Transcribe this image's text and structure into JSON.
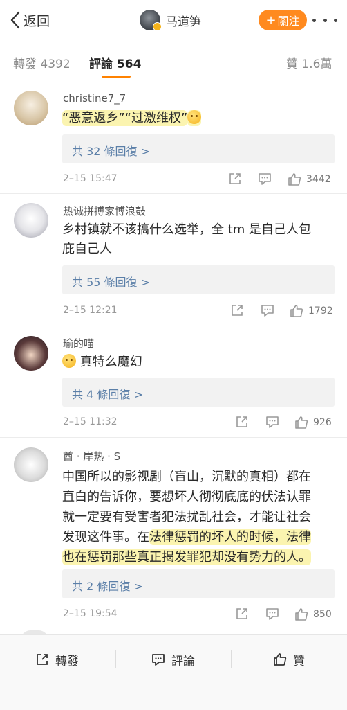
{
  "nav": {
    "back_label": "返回",
    "account_name": "马道笋",
    "follow_label": "關注",
    "follow_plus": "+"
  },
  "tabs": {
    "repost": "轉發 4392",
    "comment": "評論 564",
    "like": "贊 1.6萬"
  },
  "comments": [
    {
      "username": "christine7_7",
      "text": "“恶意返乡”“过激维权”",
      "replies": "共 32 條回復 >",
      "time": "2–15 15:47",
      "likes": "3442"
    },
    {
      "username": "热诚拼搏家博浪鼓",
      "text_line1": "乡村镇就不该搞什么选举，全 tm 是自己人包",
      "text_line2": "庇自己人",
      "replies": "共 55 條回復 >",
      "time": "2–15 12:21",
      "likes": "1792"
    },
    {
      "username": "瑜的喵",
      "text": "真特么魔幻",
      "replies": "共 4 條回復 >",
      "time": "2–15 11:32",
      "likes": "926"
    },
    {
      "username": "酋 · 岸热 · S",
      "text_line1": "中国所以的影视剧（盲山，沉默的真相）都在",
      "text_line2": "直白的告诉你，要想坏人彻彻底底的伏法认罪",
      "text_line3": "就一定要有受害者犯法扰乱社会，才能让社会",
      "text_line4a": "发现这件事。在",
      "text_line4b": "法律惩罚的坏人的时候，法律",
      "text_line5": "也在惩罚那些真正揭发罪犯却没有势力的人。",
      "replies": "共 2 條回復 >",
      "time": "2–15 19:54",
      "likes": "850"
    }
  ],
  "bottom_bar": {
    "repost": "轉發",
    "comment": "評論",
    "like": "贊"
  },
  "colors": {
    "accent": "#ff8200",
    "follow_button": "#ff8a1f",
    "reply_link": "#5b7fa8",
    "highlight": "#faf096"
  },
  "icons": [
    "chevron-left-icon",
    "more-dots-icon",
    "share-icon",
    "comment-icon",
    "thumbs-up-icon"
  ]
}
